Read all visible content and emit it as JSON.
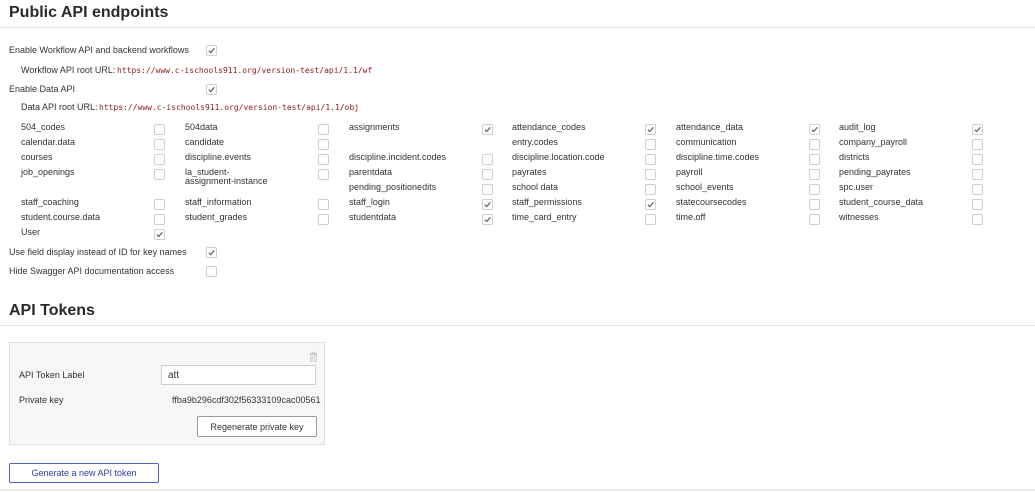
{
  "public_api": {
    "title": "Public API endpoints",
    "workflow_api": {
      "label": "Enable Workflow API and backend workflows",
      "checked": true,
      "root_label": "Workflow API root URL:",
      "root_url": "https://www.c-ischools911.org/version-test/api/1.1/wf"
    },
    "data_api": {
      "label": "Enable Data API",
      "checked": true,
      "root_label": "Data API root URL:",
      "root_url": "https://www.c-ischools911.org/version-test/api/1.1/obj"
    },
    "data_types": [
      {
        "name": "504_codes",
        "checked": false
      },
      {
        "name": "504data",
        "checked": false
      },
      {
        "name": "assignments",
        "checked": true
      },
      {
        "name": "attendance_codes",
        "checked": true
      },
      {
        "name": "attendance_data",
        "checked": true
      },
      {
        "name": "audit_log",
        "checked": true
      },
      {
        "name": "calendar.data",
        "checked": false
      },
      {
        "name": "candidate",
        "checked": false
      },
      {
        "name": "",
        "checked": false
      },
      {
        "name": "entry.codes",
        "checked": false
      },
      {
        "name": "communication",
        "checked": false
      },
      {
        "name": "company_payroll",
        "checked": false
      },
      {
        "name": "courses",
        "checked": false
      },
      {
        "name": "discipline.events",
        "checked": false
      },
      {
        "name": "discipline.incident.codes",
        "checked": false
      },
      {
        "name": "discipline.location.code",
        "checked": false
      },
      {
        "name": "discipline.time.codes",
        "checked": false
      },
      {
        "name": "districts",
        "checked": false
      },
      {
        "name": "job_openings",
        "checked": false
      },
      {
        "name": "la_student-assignment-instance",
        "checked": false
      },
      {
        "name": "parentdata",
        "checked": false
      },
      {
        "name": "payrates",
        "checked": false
      },
      {
        "name": "payroll",
        "checked": false
      },
      {
        "name": "pending_payrates",
        "checked": false
      },
      {
        "name": "",
        "checked": false
      },
      {
        "name": "",
        "checked": false
      },
      {
        "name": "pending_positionedits",
        "checked": false
      },
      {
        "name": "school data",
        "checked": false
      },
      {
        "name": "school_events",
        "checked": false
      },
      {
        "name": "spc.user",
        "checked": false
      },
      {
        "name": "staff_coaching",
        "checked": false
      },
      {
        "name": "staff_information",
        "checked": false
      },
      {
        "name": "staff_login",
        "checked": true
      },
      {
        "name": "staff_permissions",
        "checked": true
      },
      {
        "name": "statecoursecodes",
        "checked": false
      },
      {
        "name": "student_course_data",
        "checked": false
      },
      {
        "name": "student.course.data",
        "checked": false
      },
      {
        "name": "student_grades",
        "checked": false
      },
      {
        "name": "studentdata",
        "checked": true
      },
      {
        "name": "time_card_entry",
        "checked": false
      },
      {
        "name": "time.off",
        "checked": false
      },
      {
        "name": "witnesses",
        "checked": false
      },
      {
        "name": "User",
        "checked": true
      }
    ],
    "field_display": {
      "label": "Use field display instead of ID for key names",
      "checked": true
    },
    "hide_swagger": {
      "label": "Hide Swagger API documentation access",
      "checked": false
    }
  },
  "api_tokens": {
    "title": "API Tokens",
    "token": {
      "label_text": "API Token Label",
      "label_value": "att",
      "key_text": "Private key",
      "key_value": "ffba9b296cdf302f56333109cac00561",
      "regenerate_label": "Regenerate private key"
    },
    "generate_label": "Generate a new API token"
  }
}
